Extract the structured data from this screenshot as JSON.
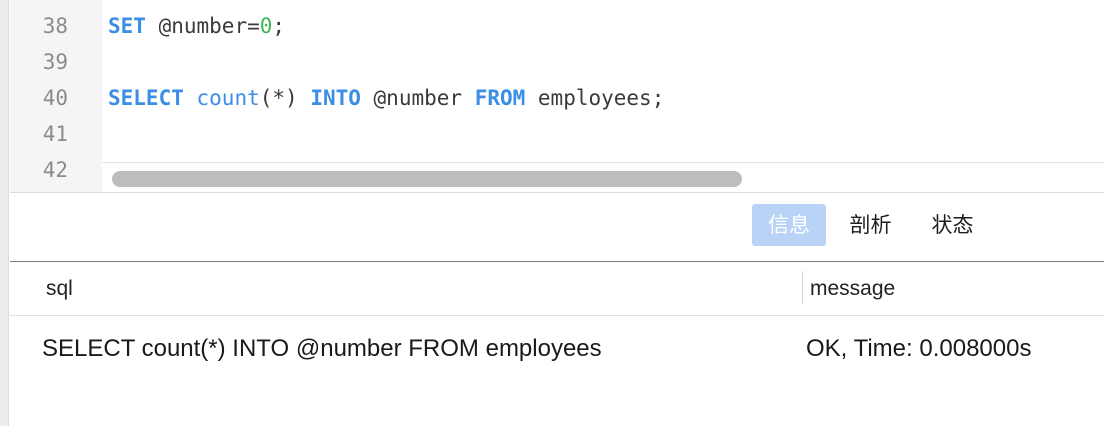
{
  "editor": {
    "lines": [
      {
        "no": "38",
        "tokens": [
          [
            "kw",
            "SET"
          ],
          [
            "plain",
            " @number="
          ],
          [
            "num",
            "0"
          ],
          [
            "plain",
            ";"
          ]
        ]
      },
      {
        "no": "39",
        "tokens": []
      },
      {
        "no": "40",
        "tokens": [
          [
            "kw",
            "SELECT"
          ],
          [
            "plain",
            " "
          ],
          [
            "fn",
            "count"
          ],
          [
            "plain",
            "(*) "
          ],
          [
            "kw",
            "INTO"
          ],
          [
            "plain",
            " @number "
          ],
          [
            "kw",
            "FROM"
          ],
          [
            "plain",
            " employees;"
          ]
        ]
      },
      {
        "no": "41",
        "tokens": []
      },
      {
        "no": "42",
        "tokens": []
      }
    ]
  },
  "tabs": {
    "info": "信息",
    "profile": "剖析",
    "status": "状态"
  },
  "result": {
    "columns": [
      "sql",
      "message"
    ],
    "rows": [
      {
        "sql": "SELECT count(*) INTO @number FROM employees",
        "message": "OK, Time: 0.008000s"
      }
    ]
  }
}
